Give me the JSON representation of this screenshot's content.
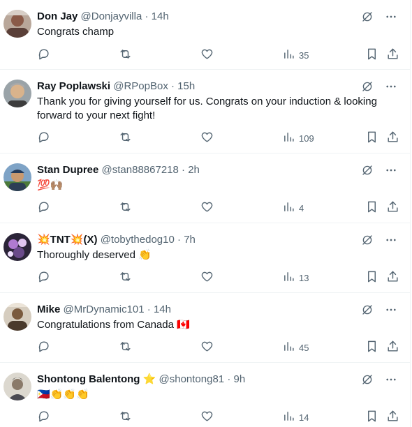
{
  "tweets": [
    {
      "name": "Don Jay",
      "handle": "@Donjayvilla",
      "dot": "·",
      "time": "14h",
      "text": "Congrats champ",
      "views": "35"
    },
    {
      "name": "Ray Poplawski",
      "handle": "@RPopBox",
      "dot": "·",
      "time": "15h",
      "text": "Thank you for giving yourself for us. Congrats on your induction & looking forward to your next fight!",
      "views": "109"
    },
    {
      "name": "Stan Dupree",
      "handle": "@stan88867218",
      "dot": "·",
      "time": "2h",
      "text": "💯🙌🏽",
      "views": "4"
    },
    {
      "name": "💥TNT💥(X)",
      "handle": "@tobythedog10",
      "dot": "·",
      "time": "7h",
      "text": "Thoroughly deserved 👏",
      "views": "13"
    },
    {
      "name": "Mike",
      "handle": "@MrDynamic101",
      "dot": "·",
      "time": "14h",
      "text": "Congratulations from Canada 🇨🇦",
      "views": "45"
    },
    {
      "name": "Shontong Balentong",
      "name_badge": "⭐",
      "handle": "@shontong81",
      "dot": "·",
      "time": "9h",
      "text": "🇵🇭👏👏👏",
      "views": "14"
    }
  ],
  "icons": {
    "grok": "grok-icon",
    "more": "more-icon",
    "reply": "reply-icon",
    "retweet": "retweet-icon",
    "like": "like-icon",
    "views": "views-icon",
    "bookmark": "bookmark-icon",
    "share": "share-icon"
  },
  "colors": {
    "text": "#0f1419",
    "secondary": "#536471",
    "divider": "#eff3f4"
  }
}
